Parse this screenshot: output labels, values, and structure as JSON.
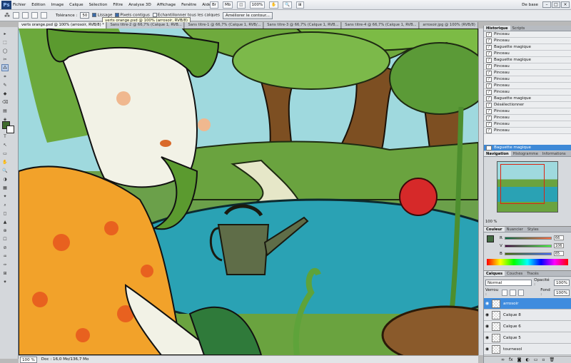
{
  "app": {
    "logo": "Ps",
    "workspace": "De base",
    "zoom": "100%",
    "menus": [
      "Fichier",
      "Edition",
      "Image",
      "Calque",
      "Sélection",
      "Filtre",
      "Analyse 3D",
      "Affichage",
      "Fenêtre",
      "Aide"
    ],
    "win_buttons": [
      "–",
      "□",
      "×"
    ],
    "menu_tools": [
      "Br",
      "Mb",
      "◫",
      "⊞"
    ]
  },
  "options": {
    "tolerance_label": "Tolérance :",
    "tolerance_value": "50",
    "lissage": "Lissage",
    "pixels_contigus": "Pixels contigus",
    "echantillonner": "Echantillonner tous les calques",
    "ameliorer": "Améliorer le contour..."
  },
  "tooltip": "verts orange.psd @ 100% (arrosoir, RVB/8)",
  "tabs": [
    "verts orange.psd @ 100% (arrosoir, RVB/8) *",
    "Sans titre-2 @ 66,7% (Calque 1, RVB...",
    "Sans titre-1 @ 66,7% (Calque 1, RVB/...",
    "Sans titre-3 @ 66,7% (Calque 1, RVB...",
    "Sans titre-4 @ 66,7% (Calque 1, RVB...",
    "arrosoir.jpg @ 100% (RVB/8)"
  ],
  "status": {
    "zoom": "100 %",
    "doc": "Doc : 16,0 Mo/136,7 Mo"
  },
  "history": {
    "tabs": [
      "Historique",
      "Scripts"
    ],
    "items": [
      "Pinceau",
      "Pinceau",
      "Baguette magique",
      "Pinceau",
      "Baguette magique",
      "Pinceau",
      "Pinceau",
      "Pinceau",
      "Pinceau",
      "Pinceau",
      "Baguette magique",
      "Désélectionner",
      "Pinceau",
      "Pinceau",
      "Pinceau",
      "Pinceau"
    ],
    "selected": "Baguette magique"
  },
  "navigator": {
    "tabs": [
      "Navigation",
      "Histogramme",
      "Informations"
    ],
    "zoom": "100 %"
  },
  "color": {
    "tabs": [
      "Couleur",
      "Nuancier",
      "Styles"
    ],
    "channels": [
      {
        "label": "R",
        "value": "66"
      },
      {
        "label": "V",
        "value": "106"
      },
      {
        "label": "B",
        "value": "65"
      }
    ],
    "fg": "#426a41"
  },
  "layers": {
    "tabs": [
      "Calques",
      "Couches",
      "Tracés"
    ],
    "mode": "Normal",
    "opacity_label": "Opacité :",
    "opacity": "100%",
    "lock_label": "Verrou :",
    "fill_label": "Fond :",
    "fill": "100%",
    "items": [
      "arrosoir",
      "Calque 8",
      "Calque 6",
      "Calque 5",
      "tournesol"
    ]
  }
}
